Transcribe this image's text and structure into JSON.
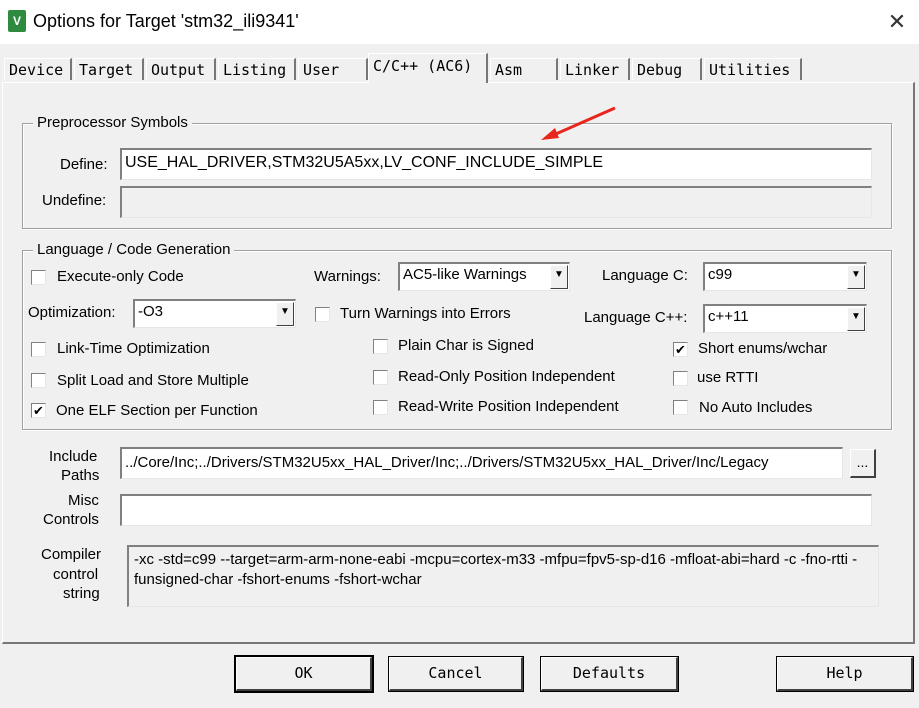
{
  "window": {
    "title": "Options for Target 'stm32_ili9341'",
    "close": "✕"
  },
  "tabs": [
    "Device",
    "Target",
    "Output",
    "Listing",
    "User",
    "C/C++ (AC6)",
    "Asm",
    "Linker",
    "Debug",
    "Utilities"
  ],
  "active_tab": "C/C++ (AC6)",
  "preprocessor": {
    "title": "Preprocessor Symbols",
    "define_label": "Define:",
    "define_value": "USE_HAL_DRIVER,STM32U5A5xx,LV_CONF_INCLUDE_SIMPLE",
    "undefine_label": "Undefine:",
    "undefine_value": ""
  },
  "language": {
    "title": "Language / Code Generation",
    "execute_only": {
      "label": "Execute-only Code",
      "checked": false
    },
    "optimization_label": "Optimization:",
    "optimization_value": "-O3",
    "link_time": {
      "label": "Link-Time Optimization",
      "checked": false
    },
    "split_load": {
      "label": "Split Load and Store Multiple",
      "checked": false
    },
    "one_elf": {
      "label": "One ELF Section per Function",
      "checked": true
    },
    "warnings_label": "Warnings:",
    "warnings_value": "AC5-like Warnings",
    "turn_warnings": {
      "label": "Turn Warnings into Errors",
      "checked": false
    },
    "plain_char": {
      "label": "Plain Char is Signed",
      "checked": false
    },
    "ro_pi": {
      "label": "Read-Only Position Independent",
      "checked": false
    },
    "rw_pi": {
      "label": "Read-Write Position Independent",
      "checked": false
    },
    "lang_c_label": "Language C:",
    "lang_c_value": "c99",
    "lang_cpp_label": "Language C++:",
    "lang_cpp_value": "c++11",
    "short_enums": {
      "label": "Short enums/wchar",
      "checked": true
    },
    "use_rtti": {
      "label": "use RTTI",
      "checked": false
    },
    "no_auto_includes": {
      "label": "No Auto Includes",
      "checked": false
    }
  },
  "include_paths": {
    "label1": "Include",
    "label2": "Paths",
    "value": "../Core/Inc;../Drivers/STM32U5xx_HAL_Driver/Inc;../Drivers/STM32U5xx_HAL_Driver/Inc/Legacy",
    "browse": "..."
  },
  "misc_controls": {
    "label1": "Misc",
    "label2": "Controls",
    "value": ""
  },
  "compiler_control": {
    "label1": "Compiler",
    "label2": "control",
    "label3": "string",
    "value": "-xc -std=c99 --target=arm-arm-none-eabi -mcpu=cortex-m33 -mfpu=fpv5-sp-d16 -mfloat-abi=hard -c -fno-rtti -funsigned-char -fshort-enums -fshort-wchar"
  },
  "buttons": {
    "ok": "OK",
    "cancel": "Cancel",
    "defaults": "Defaults",
    "help": "Help"
  },
  "check_mark": "✔",
  "dropdown_arrow": "▼",
  "colors": {
    "annotation_arrow": "#e8261e",
    "app_icon": "#2e8b3e"
  }
}
